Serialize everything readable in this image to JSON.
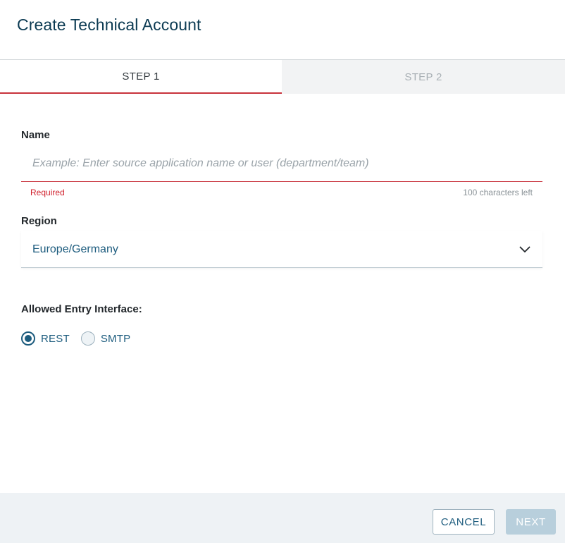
{
  "dialog": {
    "title": "Create Technical Account"
  },
  "tabs": [
    {
      "label": "STEP 1",
      "active": true
    },
    {
      "label": "STEP 2",
      "active": false
    }
  ],
  "form": {
    "name": {
      "label": "Name",
      "value": "",
      "placeholder": "Example: Enter source application name or user (department/team)",
      "error": "Required",
      "counter": "100 characters left"
    },
    "region": {
      "label": "Region",
      "selected": "Europe/Germany"
    },
    "entry_interface": {
      "label": "Allowed Entry Interface:",
      "options": [
        {
          "label": "REST",
          "checked": true
        },
        {
          "label": "SMTP",
          "checked": false
        }
      ]
    }
  },
  "footer": {
    "cancel_label": "CANCEL",
    "next_label": "NEXT"
  },
  "colors": {
    "accent": "#1d5c7e",
    "error": "#d0202c",
    "title": "#0b3a52",
    "disabled_button": "#b8cfdc"
  },
  "icons": {
    "region_dropdown": "chevron-down-icon"
  }
}
